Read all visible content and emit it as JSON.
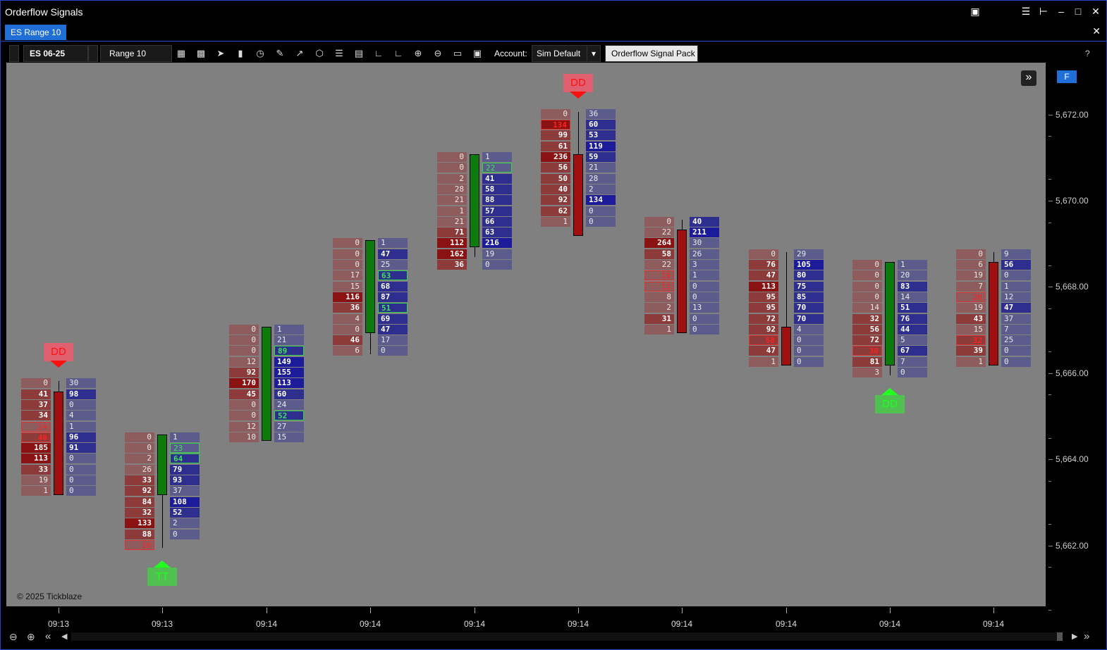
{
  "app_title": "Orderflow Signals",
  "tab": {
    "label": "ES Range 10"
  },
  "toolbar": {
    "instrument": "ES 06-25",
    "bar_type": "Range 10",
    "account_label": "Account:",
    "account_value": "Sim Default",
    "strategy_button": "Orderflow Signal Pack",
    "help": "?"
  },
  "chart_overlay": {
    "copyright": "© 2025 Tickblaze",
    "f_button": "F",
    "expand_icon": "»"
  },
  "colors": {
    "chart_bg": "#808080",
    "bullish_candle": "#0d7a0d",
    "bearish_candle": "#a01010",
    "signal_red": "#ff1010",
    "signal_green": "#20ff20",
    "ask_strong": "#1c1c9a",
    "bid_strong": "#8a1010"
  },
  "y_axis": {
    "labels": [
      "5,672.00",
      "5,670.00",
      "5,668.00",
      "5,666.00",
      "5,664.00",
      "5,662.00"
    ]
  },
  "x_axis": {
    "labels": [
      "09:13",
      "09:13",
      "09:14",
      "09:14",
      "09:14",
      "09:14",
      "09:14",
      "09:14",
      "09:14",
      "09:14"
    ]
  },
  "chart_data": {
    "type": "footprint",
    "tick_size": 0.25,
    "bars": [
      {
        "time": "09:13",
        "top": 5665.75,
        "open": 5665.5,
        "close": 5663.25,
        "high": 5665.75,
        "low": 5663.25,
        "bid": [
          "0",
          "41",
          "37",
          "34",
          "24",
          "40",
          "185",
          "113",
          "33",
          "19",
          "1"
        ],
        "ask": [
          "30",
          "98",
          "0",
          "4",
          "1",
          "96",
          "91",
          "0",
          "0",
          "0",
          "0"
        ],
        "bid_imb": [
          4,
          5
        ],
        "ask_imb": [],
        "signal": {
          "label": "DD",
          "dir": "down",
          "color": "red"
        }
      },
      {
        "time": "09:13",
        "top": 5664.5,
        "open": 5663.25,
        "close": 5664.5,
        "high": 5664.5,
        "low": 5662.0,
        "bid": [
          "0",
          "0",
          "2",
          "26",
          "33",
          "92",
          "84",
          "32",
          "133",
          "88",
          "10"
        ],
        "ask": [
          "1",
          "23",
          "64",
          "79",
          "93",
          "37",
          "108",
          "52",
          "2",
          "0"
        ],
        "bid_imb": [
          10
        ],
        "ask_imb": [
          1,
          2
        ],
        "signal": {
          "label": "TT",
          "dir": "up",
          "color": "green"
        }
      },
      {
        "time": "09:14",
        "top": 5667.0,
        "open": 5664.5,
        "close": 5667.0,
        "high": 5667.0,
        "low": 5664.5,
        "bid": [
          "0",
          "0",
          "0",
          "12",
          "92",
          "170",
          "45",
          "0",
          "0",
          "12",
          "10"
        ],
        "ask": [
          "1",
          "21",
          "89",
          "149",
          "155",
          "113",
          "60",
          "24",
          "52",
          "27",
          "15"
        ],
        "bid_imb": [],
        "ask_imb": [
          2,
          8
        ],
        "signal": null
      },
      {
        "time": "09:14",
        "top": 5669.0,
        "open": 5667.0,
        "close": 5669.0,
        "high": 5669.0,
        "low": 5666.5,
        "bid": [
          "0",
          "0",
          "0",
          "17",
          "15",
          "116",
          "36",
          "4",
          "0",
          "46",
          "6"
        ],
        "ask": [
          "1",
          "47",
          "25",
          "63",
          "68",
          "87",
          "51",
          "69",
          "47",
          "17",
          "0"
        ],
        "bid_imb": [],
        "ask_imb": [
          3,
          6
        ],
        "signal": null
      },
      {
        "time": "09:14",
        "top": 5671.0,
        "open": 5669.0,
        "close": 5671.0,
        "high": 5671.0,
        "low": 5668.75,
        "bid": [
          "0",
          "0",
          "2",
          "28",
          "21",
          "1",
          "21",
          "71",
          "112",
          "162",
          "36"
        ],
        "ask": [
          "1",
          "22",
          "41",
          "58",
          "88",
          "57",
          "66",
          "63",
          "216",
          "19",
          "0"
        ],
        "bid_imb": [],
        "ask_imb": [
          1
        ],
        "signal": null
      },
      {
        "time": "09:14",
        "top": 5672.0,
        "open": 5671.0,
        "close": 5669.25,
        "high": 5672.0,
        "low": 5669.25,
        "bid": [
          "0",
          "134",
          "99",
          "61",
          "236",
          "56",
          "50",
          "40",
          "92",
          "62",
          "1"
        ],
        "ask": [
          "36",
          "60",
          "53",
          "119",
          "59",
          "21",
          "28",
          "2",
          "134",
          "0",
          "0"
        ],
        "bid_imb": [
          1
        ],
        "ask_imb": [],
        "signal": {
          "label": "DD",
          "dir": "down",
          "color": "red"
        }
      },
      {
        "time": "09:14",
        "top": 5669.5,
        "open": 5669.25,
        "close": 5667.0,
        "high": 5669.5,
        "low": 5667.0,
        "bid": [
          "0",
          "22",
          "264",
          "58",
          "22",
          "19",
          "13",
          "8",
          "2",
          "31",
          "1"
        ],
        "ask": [
          "40",
          "211",
          "30",
          "26",
          "3",
          "1",
          "0",
          "0",
          "13",
          "0",
          "0"
        ],
        "bid_imb": [
          5,
          6
        ],
        "ask_imb": [],
        "signal": null
      },
      {
        "time": "09:14",
        "top": 5668.75,
        "open": 5667.0,
        "close": 5666.25,
        "high": 5668.75,
        "low": 5666.25,
        "bid": [
          "0",
          "76",
          "47",
          "113",
          "95",
          "95",
          "72",
          "92",
          "58",
          "47",
          "1"
        ],
        "ask": [
          "29",
          "105",
          "80",
          "75",
          "85",
          "70",
          "70",
          "4",
          "0",
          "0",
          "0"
        ],
        "bid_imb": [
          8
        ],
        "ask_imb": [],
        "signal": null
      },
      {
        "time": "09:14",
        "top": 5668.5,
        "open": 5666.25,
        "close": 5668.5,
        "high": 5668.5,
        "low": 5666.0,
        "bid": [
          "0",
          "0",
          "0",
          "0",
          "14",
          "32",
          "56",
          "72",
          "30",
          "81",
          "3"
        ],
        "ask": [
          "1",
          "20",
          "83",
          "14",
          "51",
          "76",
          "44",
          "5",
          "67",
          "7",
          "0"
        ],
        "bid_imb": [
          8
        ],
        "ask_imb": [],
        "signal": {
          "label": "DD",
          "dir": "up",
          "color": "green"
        }
      },
      {
        "time": "09:14",
        "top": 5668.75,
        "open": 5668.5,
        "close": 5666.25,
        "high": 5668.75,
        "low": 5666.25,
        "bid": [
          "0",
          "6",
          "19",
          "7",
          "20",
          "19",
          "43",
          "15",
          "32",
          "39",
          "1"
        ],
        "ask": [
          "9",
          "56",
          "0",
          "1",
          "12",
          "47",
          "37",
          "7",
          "25",
          "0",
          "0"
        ],
        "bid_imb": [
          4,
          8
        ],
        "ask_imb": [],
        "signal": null
      }
    ]
  }
}
